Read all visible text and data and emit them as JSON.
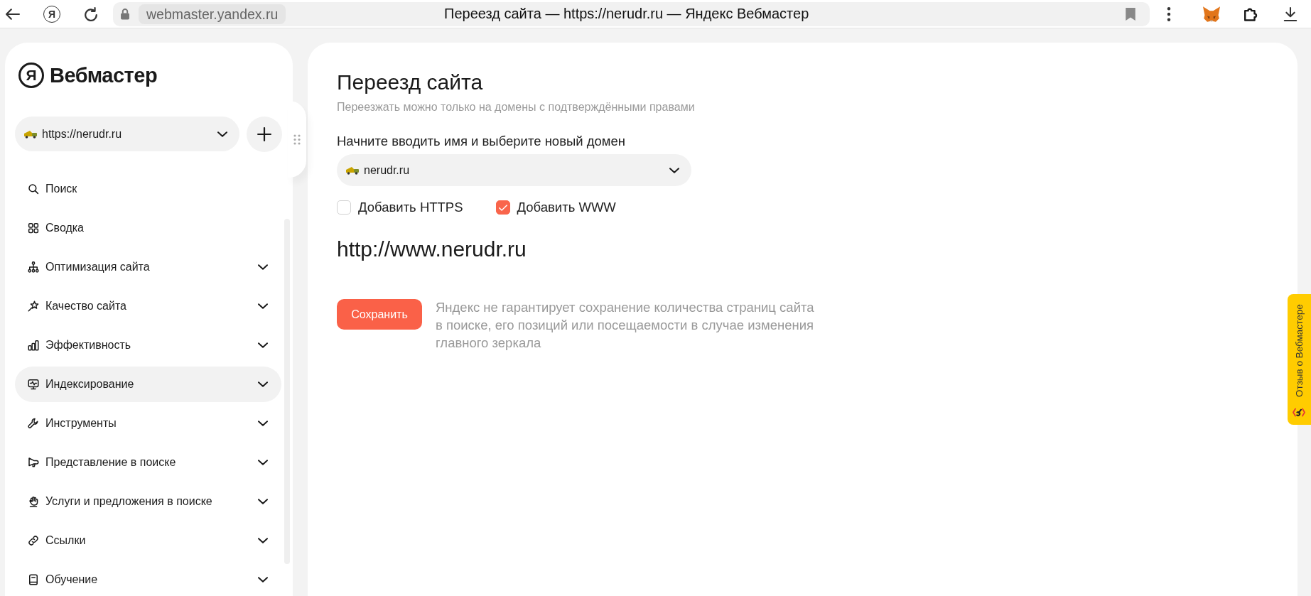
{
  "browser": {
    "home_button": "Я",
    "address": "webmaster.yandex.ru",
    "page_title": "Переезд сайта — https://nerudr.ru — Яндекс Вебмастер"
  },
  "sidebar": {
    "logo": {
      "mark": "Я",
      "name": "Вебмастер"
    },
    "site_select": {
      "value": "https://nerudr.ru"
    },
    "menu": [
      {
        "label": "Поиск",
        "expandable": false,
        "selected": false
      },
      {
        "label": "Сводка",
        "expandable": false,
        "selected": false
      },
      {
        "label": "Оптимизация сайта",
        "expandable": true,
        "selected": false
      },
      {
        "label": "Качество сайта",
        "expandable": true,
        "selected": false
      },
      {
        "label": "Эффективность",
        "expandable": true,
        "selected": false
      },
      {
        "label": "Индексирование",
        "expandable": true,
        "selected": true
      },
      {
        "label": "Инструменты",
        "expandable": true,
        "selected": false
      },
      {
        "label": "Представление в поиске",
        "expandable": true,
        "selected": false
      },
      {
        "label": "Услуги и предложения в поиске",
        "expandable": true,
        "selected": false
      },
      {
        "label": "Ссылки",
        "expandable": true,
        "selected": false
      },
      {
        "label": "Обучение",
        "expandable": true,
        "selected": false
      }
    ]
  },
  "main": {
    "title": "Переезд сайта",
    "subtitle": "Переезжать можно только на домены с подтверждёнными правами",
    "domain_field": {
      "label": "Начните вводить имя и выберите новый домен",
      "value": "nerudr.ru"
    },
    "options": [
      {
        "label": "Добавить HTTPS",
        "checked": false
      },
      {
        "label": "Добавить WWW",
        "checked": true
      }
    ],
    "result_url": "http://www.nerudr.ru",
    "save_button": "Сохранить",
    "note": "Яндекс не гарантирует сохранение количества страниц сайта в поиске, его позиций или посещаемости в случае изменения главного зеркала"
  },
  "feedback_tab": {
    "label": "Отзыв о Вебмастере"
  }
}
